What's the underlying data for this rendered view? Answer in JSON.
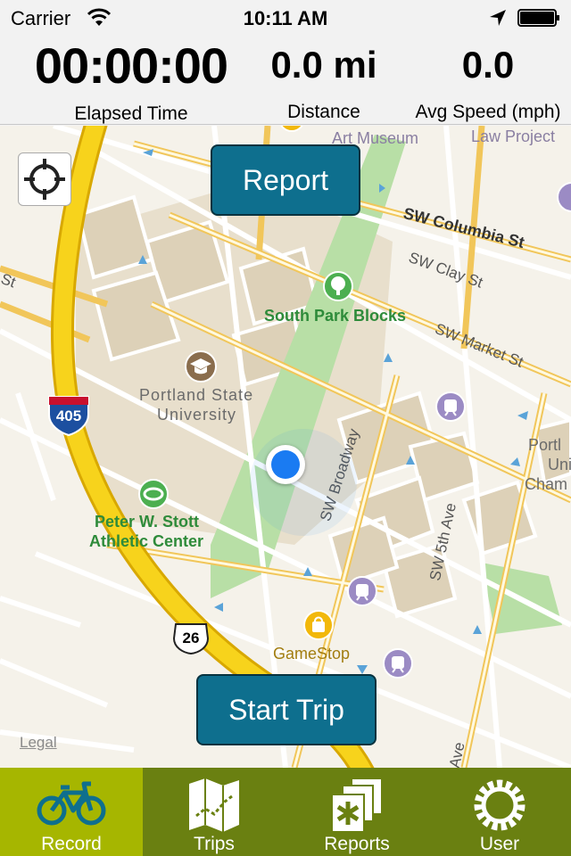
{
  "status_bar": {
    "carrier": "Carrier",
    "time": "10:11 AM"
  },
  "stats": {
    "elapsed_time": {
      "value": "00:00:00",
      "label": "Elapsed Time"
    },
    "distance": {
      "value": "0.0 mi",
      "label": "Distance"
    },
    "avg_speed": {
      "value": "0.0",
      "label": "Avg Speed (mph)"
    }
  },
  "map": {
    "report_button": "Report",
    "start_trip_button": "Start Trip",
    "legal": "Legal",
    "labels": {
      "art_museum": "Art Museum",
      "law_project": "Law Project",
      "sw_columbia": "SW Columbia St",
      "sw_clay": "SW Clay St",
      "sw_market": "SW Market St",
      "sw_broadway": "SW Broadway",
      "sw_5th": "SW 5th Ave",
      "st_left": "St",
      "south_park_blocks": "South Park Blocks",
      "portland_state_line1": "Portland State",
      "portland_state_line2": "University",
      "stott_line1": "Peter W. Stott",
      "stott_line2": "Athletic Center",
      "gamestop": "GameStop",
      "portland_partial_1": "Portl",
      "portland_partial_2": "Uni",
      "portland_partial_3": "Cham",
      "ave_partial": "Ave",
      "shield_405": "405",
      "shield_26": "26"
    },
    "colors": {
      "freeway": "#f7d31c",
      "park": "#b8dfa6",
      "campus": "#e8dfcc",
      "location_dot": "#1a7bf2"
    }
  },
  "tabs": [
    {
      "label": "Record",
      "icon": "bicycle-icon",
      "active": true
    },
    {
      "label": "Trips",
      "icon": "map-icon",
      "active": false
    },
    {
      "label": "Reports",
      "icon": "reports-icon",
      "active": false
    },
    {
      "label": "User",
      "icon": "gear-icon",
      "active": false
    }
  ],
  "theme": {
    "button_blue": "#0e6f8e",
    "tabbar_green": "#6a8011",
    "tab_active": "#a6b600"
  }
}
